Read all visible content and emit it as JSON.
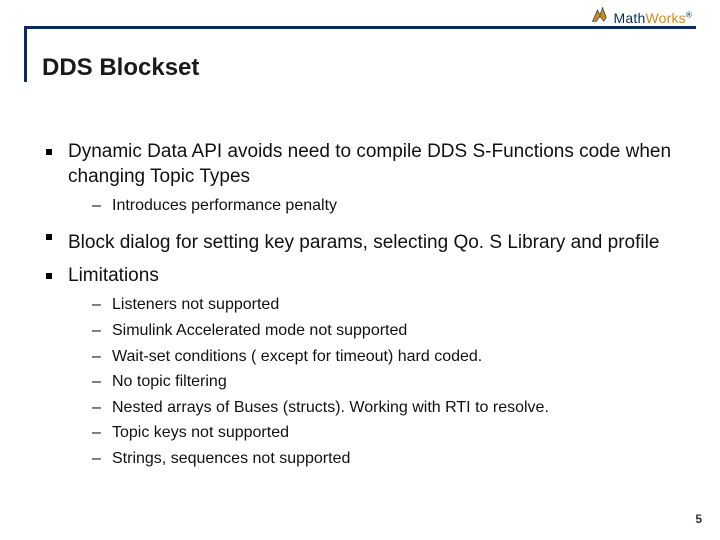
{
  "brand": {
    "name_prefix": "Math",
    "name_suffix": "Works",
    "registered": "®"
  },
  "title": "DDS Blockset",
  "page_number": "5",
  "bullets": [
    {
      "text": "Dynamic Data API avoids need to compile DDS S-Functions code when changing Topic Types",
      "sub": [
        "Introduces performance penalty"
      ]
    },
    {
      "text": "Block dialog for setting key params, selecting Qo. S Library and profile",
      "sub": []
    },
    {
      "text": "Limitations",
      "sub": [
        "Listeners not supported",
        "Simulink Accelerated mode not supported",
        "Wait-set conditions ( except for timeout) hard coded.",
        "No topic filtering",
        "Nested arrays of Buses (structs). Working with RTI to resolve.",
        "Topic keys not supported",
        "Strings, sequences not supported"
      ]
    }
  ]
}
